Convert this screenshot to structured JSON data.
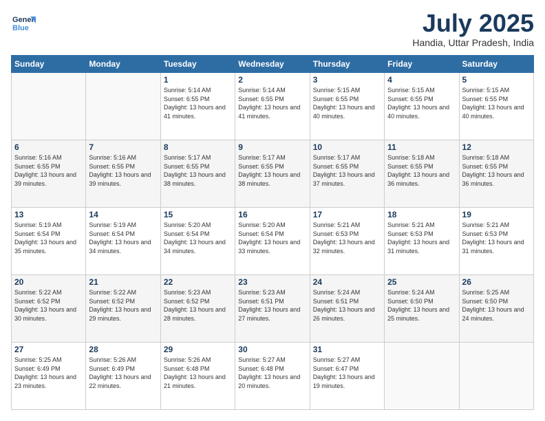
{
  "logo": {
    "line1": "General",
    "line2": "Blue"
  },
  "title": "July 2025",
  "location": "Handia, Uttar Pradesh, India",
  "days_of_week": [
    "Sunday",
    "Monday",
    "Tuesday",
    "Wednesday",
    "Thursday",
    "Friday",
    "Saturday"
  ],
  "weeks": [
    [
      null,
      null,
      {
        "num": "1",
        "sunrise": "5:14 AM",
        "sunset": "6:55 PM",
        "daylight": "13 hours and 41 minutes."
      },
      {
        "num": "2",
        "sunrise": "5:14 AM",
        "sunset": "6:55 PM",
        "daylight": "13 hours and 41 minutes."
      },
      {
        "num": "3",
        "sunrise": "5:15 AM",
        "sunset": "6:55 PM",
        "daylight": "13 hours and 40 minutes."
      },
      {
        "num": "4",
        "sunrise": "5:15 AM",
        "sunset": "6:55 PM",
        "daylight": "13 hours and 40 minutes."
      },
      {
        "num": "5",
        "sunrise": "5:15 AM",
        "sunset": "6:55 PM",
        "daylight": "13 hours and 40 minutes."
      }
    ],
    [
      {
        "num": "6",
        "sunrise": "5:16 AM",
        "sunset": "6:55 PM",
        "daylight": "13 hours and 39 minutes."
      },
      {
        "num": "7",
        "sunrise": "5:16 AM",
        "sunset": "6:55 PM",
        "daylight": "13 hours and 39 minutes."
      },
      {
        "num": "8",
        "sunrise": "5:17 AM",
        "sunset": "6:55 PM",
        "daylight": "13 hours and 38 minutes."
      },
      {
        "num": "9",
        "sunrise": "5:17 AM",
        "sunset": "6:55 PM",
        "daylight": "13 hours and 38 minutes."
      },
      {
        "num": "10",
        "sunrise": "5:17 AM",
        "sunset": "6:55 PM",
        "daylight": "13 hours and 37 minutes."
      },
      {
        "num": "11",
        "sunrise": "5:18 AM",
        "sunset": "6:55 PM",
        "daylight": "13 hours and 36 minutes."
      },
      {
        "num": "12",
        "sunrise": "5:18 AM",
        "sunset": "6:55 PM",
        "daylight": "13 hours and 36 minutes."
      }
    ],
    [
      {
        "num": "13",
        "sunrise": "5:19 AM",
        "sunset": "6:54 PM",
        "daylight": "13 hours and 35 minutes."
      },
      {
        "num": "14",
        "sunrise": "5:19 AM",
        "sunset": "6:54 PM",
        "daylight": "13 hours and 34 minutes."
      },
      {
        "num": "15",
        "sunrise": "5:20 AM",
        "sunset": "6:54 PM",
        "daylight": "13 hours and 34 minutes."
      },
      {
        "num": "16",
        "sunrise": "5:20 AM",
        "sunset": "6:54 PM",
        "daylight": "13 hours and 33 minutes."
      },
      {
        "num": "17",
        "sunrise": "5:21 AM",
        "sunset": "6:53 PM",
        "daylight": "13 hours and 32 minutes."
      },
      {
        "num": "18",
        "sunrise": "5:21 AM",
        "sunset": "6:53 PM",
        "daylight": "13 hours and 31 minutes."
      },
      {
        "num": "19",
        "sunrise": "5:21 AM",
        "sunset": "6:53 PM",
        "daylight": "13 hours and 31 minutes."
      }
    ],
    [
      {
        "num": "20",
        "sunrise": "5:22 AM",
        "sunset": "6:52 PM",
        "daylight": "13 hours and 30 minutes."
      },
      {
        "num": "21",
        "sunrise": "5:22 AM",
        "sunset": "6:52 PM",
        "daylight": "13 hours and 29 minutes."
      },
      {
        "num": "22",
        "sunrise": "5:23 AM",
        "sunset": "6:52 PM",
        "daylight": "13 hours and 28 minutes."
      },
      {
        "num": "23",
        "sunrise": "5:23 AM",
        "sunset": "6:51 PM",
        "daylight": "13 hours and 27 minutes."
      },
      {
        "num": "24",
        "sunrise": "5:24 AM",
        "sunset": "6:51 PM",
        "daylight": "13 hours and 26 minutes."
      },
      {
        "num": "25",
        "sunrise": "5:24 AM",
        "sunset": "6:50 PM",
        "daylight": "13 hours and 25 minutes."
      },
      {
        "num": "26",
        "sunrise": "5:25 AM",
        "sunset": "6:50 PM",
        "daylight": "13 hours and 24 minutes."
      }
    ],
    [
      {
        "num": "27",
        "sunrise": "5:25 AM",
        "sunset": "6:49 PM",
        "daylight": "13 hours and 23 minutes."
      },
      {
        "num": "28",
        "sunrise": "5:26 AM",
        "sunset": "6:49 PM",
        "daylight": "13 hours and 22 minutes."
      },
      {
        "num": "29",
        "sunrise": "5:26 AM",
        "sunset": "6:48 PM",
        "daylight": "13 hours and 21 minutes."
      },
      {
        "num": "30",
        "sunrise": "5:27 AM",
        "sunset": "6:48 PM",
        "daylight": "13 hours and 20 minutes."
      },
      {
        "num": "31",
        "sunrise": "5:27 AM",
        "sunset": "6:47 PM",
        "daylight": "13 hours and 19 minutes."
      },
      null,
      null
    ]
  ],
  "labels": {
    "sunrise_prefix": "Sunrise: ",
    "sunset_prefix": "Sunset: ",
    "daylight_prefix": "Daylight: "
  }
}
